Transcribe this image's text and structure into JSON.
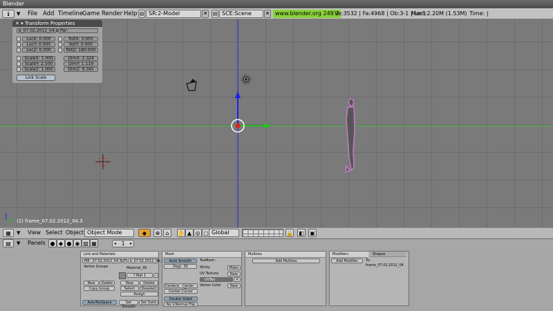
{
  "window": {
    "title": "Blender"
  },
  "menubar": {
    "items": [
      "File",
      "Add",
      "Timeline",
      "Game",
      "Render",
      "Help"
    ],
    "screen": "SR:2-Model",
    "scene": "SCE:Scene",
    "url": "www.blender.org 249.2",
    "stats": "Ve:3532 | Fa:4968 | Ob:3-1 | La:1",
    "mem": "Mem:2.20M (1.53M)",
    "time": "Time: | frame_07.02.2012_04.3"
  },
  "transform_panel": {
    "title": "Transform Properties",
    "name": "e_07.02.2012_04.3",
    "parent": "Par:",
    "loc": [
      "LocX: 0.000",
      "LocY: 0.000",
      "LocZ: 0.000"
    ],
    "rot": [
      "RotX: 3.000",
      "RotY: 0.000",
      "RotZ: 180.000"
    ],
    "scale": [
      "ScaleX: 1.000",
      "ScaleY: 2.500",
      "ScaleZ: 1.000"
    ],
    "dim": [
      "DimX: 2.324",
      "DimY: 1.119",
      "DimZ: 9.345"
    ],
    "link_scale": "Link Scale"
  },
  "viewport": {
    "frame_label": "(1) frame_07.02.2012_04.3"
  },
  "view_header": {
    "menus": [
      "View",
      "Select",
      "Object"
    ],
    "mode": "Object Mode",
    "orientation": "Global"
  },
  "buttons_header": {
    "panels_label": "Panels",
    "frame": "1"
  },
  "link_materials": {
    "title": "Link and Materials",
    "me_field": "ME:_07.02.2012_04.3",
    "f_field": "F",
    "ob_field": "b_07.02.2012_04.3",
    "vertex_groups": "Vertex Groups",
    "material_label": "Material_39",
    "mat_index": "? Mat 1",
    "new": "New",
    "delete": "Delete",
    "copy_group": "Copy Group",
    "select": "Select",
    "deselect": "Deselect",
    "assign": "Assign",
    "autotexspace": "AutoTexSpace",
    "set_smooth": "Set Smooth",
    "set_solid": "Set Solid"
  },
  "mesh": {
    "title": "Mesh",
    "auto_smooth": "Auto Smooth",
    "degr": "Degr: 30",
    "texmesh": "TexMesh:",
    "sticky": "Sticky",
    "make": "Make",
    "uv_texture": "UV Texture",
    "new": "New",
    "uvtex": "UVTex",
    "vertex_color": "Vertex Color",
    "new2": "New",
    "center": "Center",
    "center_new": "Center New",
    "center_cursor": "Center Cursor",
    "double_sided": "Double Sided",
    "no_vnormal": "No V.Normal Flip"
  },
  "multires": {
    "title": "Multires",
    "add": "Add Multires"
  },
  "modifiers": {
    "title": "Modifiers",
    "tab2": "Shapes",
    "add": "Add Modifier",
    "to": "To: frame_07.02.2012_04"
  },
  "colors": {
    "grid_bg": "#7a7a7a",
    "x_axis": "#3fbf3f",
    "y_axis": "#2c2cdc",
    "object_outline": "#c77ac9",
    "url_bg": "#88d03a"
  }
}
